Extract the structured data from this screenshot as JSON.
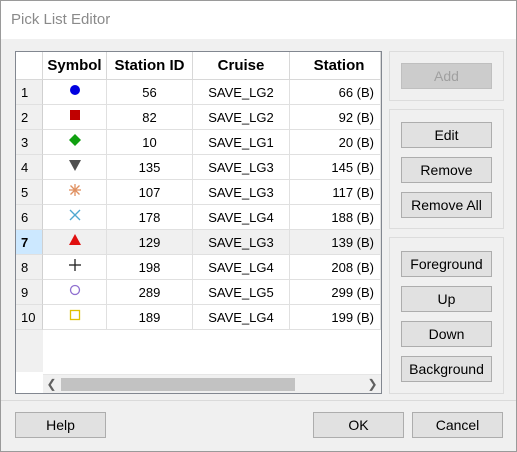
{
  "window": {
    "title": "Pick List Editor"
  },
  "table": {
    "columns": [
      "Symbol",
      "Station ID",
      "Cruise",
      "Station"
    ],
    "selected_row": 7,
    "rows": [
      {
        "num": "1",
        "symbol": "filled-circle",
        "color": "#0000e0",
        "station_id": "56",
        "cruise": "SAVE_LG2",
        "station": "66 (B)"
      },
      {
        "num": "2",
        "symbol": "filled-square",
        "color": "#c00000",
        "station_id": "82",
        "cruise": "SAVE_LG2",
        "station": "92 (B)"
      },
      {
        "num": "3",
        "symbol": "filled-diamond",
        "color": "#10a010",
        "station_id": "10",
        "cruise": "SAVE_LG1",
        "station": "20 (B)"
      },
      {
        "num": "4",
        "symbol": "filled-down-triangle",
        "color": "#505050",
        "station_id": "135",
        "cruise": "SAVE_LG3",
        "station": "145 (B)"
      },
      {
        "num": "5",
        "symbol": "asterisk",
        "color": "#e09060",
        "station_id": "107",
        "cruise": "SAVE_LG3",
        "station": "117 (B)"
      },
      {
        "num": "6",
        "symbol": "x-cross",
        "color": "#50a8d0",
        "station_id": "178",
        "cruise": "SAVE_LG4",
        "station": "188 (B)"
      },
      {
        "num": "7",
        "symbol": "filled-up-triangle",
        "color": "#e01010",
        "station_id": "129",
        "cruise": "SAVE_LG3",
        "station": "139 (B)"
      },
      {
        "num": "8",
        "symbol": "plus",
        "color": "#202020",
        "station_id": "198",
        "cruise": "SAVE_LG4",
        "station": "208 (B)"
      },
      {
        "num": "9",
        "symbol": "open-circle",
        "color": "#9070d0",
        "station_id": "289",
        "cruise": "SAVE_LG5",
        "station": "299 (B)"
      },
      {
        "num": "10",
        "symbol": "open-square",
        "color": "#e0c000",
        "station_id": "189",
        "cruise": "SAVE_LG4",
        "station": "199 (B)"
      }
    ],
    "scroll_left_icon": "arrow-left-icon",
    "scroll_right_icon": "arrow-right-icon"
  },
  "buttons": {
    "add": "Add",
    "edit": "Edit",
    "remove": "Remove",
    "remove_all": "Remove All",
    "foreground": "Foreground",
    "up": "Up",
    "down": "Down",
    "background": "Background",
    "help": "Help",
    "ok": "OK",
    "cancel": "Cancel"
  }
}
